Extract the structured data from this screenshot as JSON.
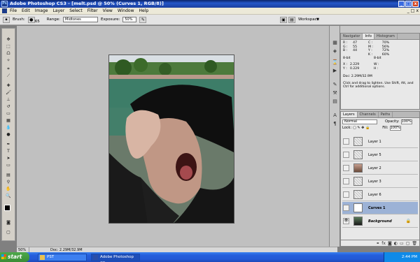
{
  "window": {
    "title": "Adobe Photoshop CS3 - [melt.psd @ 50% (Curves 1, RGB/8)]",
    "logo_label": "Ps",
    "buttons": {
      "minimize": "_",
      "maximize": "□",
      "close": "x"
    }
  },
  "menu": {
    "items": [
      "File",
      "Edit",
      "Image",
      "Layer",
      "Select",
      "Filter",
      "View",
      "Window",
      "Help"
    ]
  },
  "options": {
    "brush_label": "Brush:",
    "brush_size": "65",
    "range_label": "Range:",
    "range_value": "Midtones",
    "exposure_label": "Exposure:",
    "exposure_value": "50%",
    "workspace_label": "Workspace"
  },
  "status": {
    "zoom": "50%",
    "doc": "Doc: 2.29M/32.9M"
  },
  "navigator_tabs": [
    "Navigator",
    "Info",
    "Histogram"
  ],
  "info": {
    "rgb": [
      [
        "R :",
        "47"
      ],
      [
        "G :",
        "55"
      ],
      [
        "B :",
        "44"
      ]
    ],
    "cmyk": [
      [
        "C :",
        "70%"
      ],
      [
        "M :",
        "56%"
      ],
      [
        "Y :",
        "72%"
      ],
      [
        "K :",
        "60%"
      ]
    ],
    "bit_left": "8-bit",
    "bit_right": "8-bit",
    "xy": [
      [
        "X :",
        "2.229"
      ],
      [
        "Y :",
        "0.229"
      ]
    ],
    "wh": [
      [
        "W :",
        ""
      ],
      [
        "H :",
        ""
      ]
    ],
    "doc": "Doc: 2.29M/32.9M",
    "hint": "Click and drag to lighten. Use Shift, Alt, and Ctrl for additional options."
  },
  "layers_tabs": [
    "Layers",
    "Channels",
    "Paths"
  ],
  "layers_opts": {
    "blend": "Normal",
    "opacity_label": "Opacity:",
    "opacity": "100%",
    "lock_label": "Lock:",
    "fill_label": "Fill:",
    "fill": "100%"
  },
  "layers": [
    {
      "name": "Layer 1",
      "selected": false,
      "thumb": "checker"
    },
    {
      "name": "Layer 5",
      "selected": false,
      "thumb": "checker"
    },
    {
      "name": "Layer 2",
      "selected": false,
      "thumb": "face"
    },
    {
      "name": "Layer 3",
      "selected": false,
      "thumb": "checker"
    },
    {
      "name": "Layer 6",
      "selected": false,
      "thumb": "checker"
    },
    {
      "name": "Curves 1",
      "selected": true,
      "thumb": "curves"
    },
    {
      "name": "Background",
      "selected": false,
      "thumb": "photo",
      "locked": true
    }
  ],
  "taskbar": {
    "start": "start",
    "tasks": [
      {
        "label": "PST",
        "icon": "folder"
      },
      {
        "label": "Adobe Photoshop CS...",
        "icon": "ps",
        "active": true
      }
    ],
    "clock": "2:44 PM"
  }
}
